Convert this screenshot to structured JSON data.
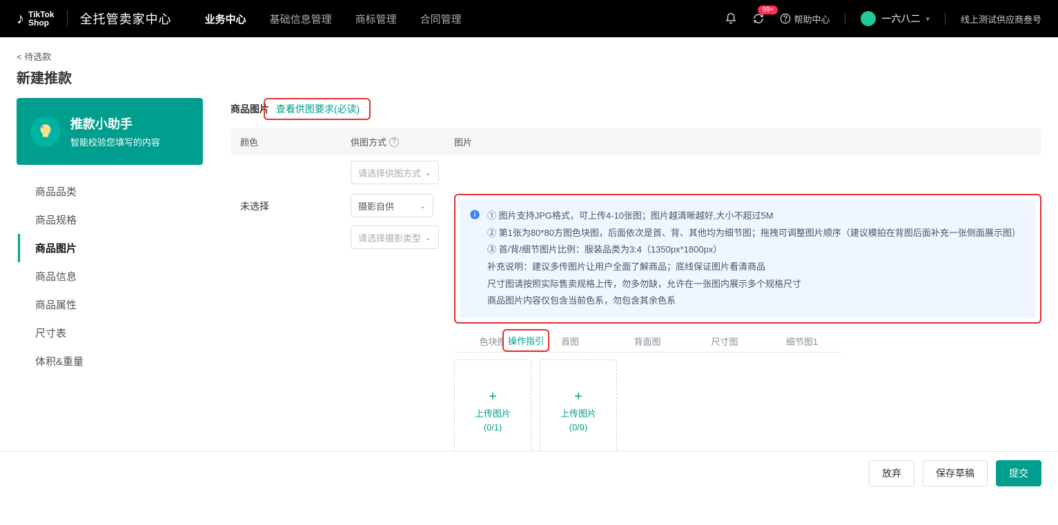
{
  "header": {
    "logo_top": "TikTok",
    "logo_bottom": "Shop",
    "brand": "全托管卖家中心",
    "nav": [
      "业务中心",
      "基础信息管理",
      "商标管理",
      "合同管理"
    ],
    "active_nav": 0,
    "badge": "99+",
    "help": "帮助中心",
    "user": "一六八二",
    "supplier": "线上测试供应商叁号"
  },
  "breadcrumb": "< 待选款",
  "page_title": "新建推款",
  "assistant": {
    "title": "推款小助手",
    "subtitle": "智能校验您填写的内容"
  },
  "sidebar_items": [
    "商品品类",
    "商品规格",
    "商品图片",
    "商品信息",
    "商品属性",
    "尺寸表",
    "体积&重量"
  ],
  "sidebar_active": 2,
  "section": {
    "label": "商品图片",
    "link": "查看供图要求(必读)",
    "columns": {
      "c1": "颜色",
      "c2": "供图方式",
      "c2_help": "?",
      "c3": "图片"
    },
    "top_select_placeholder": "请选择供图方式",
    "row_label": "未选择",
    "row_select1": "摄影自供",
    "row_select2_placeholder": "请选择摄影类型"
  },
  "info_lines": [
    "① 图片支持JPG格式，可上传4-10张图；图片越清晰越好,大小不超过5M",
    "② 第1张为80*80方图色块图，后面依次是首、背、其他均为细节图；拖拽可调整图片顺序（建议模拍在背图后面补充一张侧面展示图）",
    "③ 首/背/细节图片比例：服装品类为3:4（1350px*1800px）",
    "补充说明：建议多传图片让用户全面了解商品；底线保证图片看清商品",
    "尺寸图请按照实际售卖规格上传，勿多勿缺，允许在一张图内展示多个规格尺寸",
    "商品图片内容仅包含当前色系，勿包含其余色系"
  ],
  "img_tabs": [
    "色块图",
    "首图",
    "背面图",
    "尺寸图",
    "细节图1"
  ],
  "guide_label": "操作指引",
  "upload": {
    "label": "上传图片",
    "box1_count": "(0/1)",
    "box2_count": "(0/9)"
  },
  "footer": {
    "discard": "放弃",
    "draft": "保存草稿",
    "submit": "提交"
  }
}
